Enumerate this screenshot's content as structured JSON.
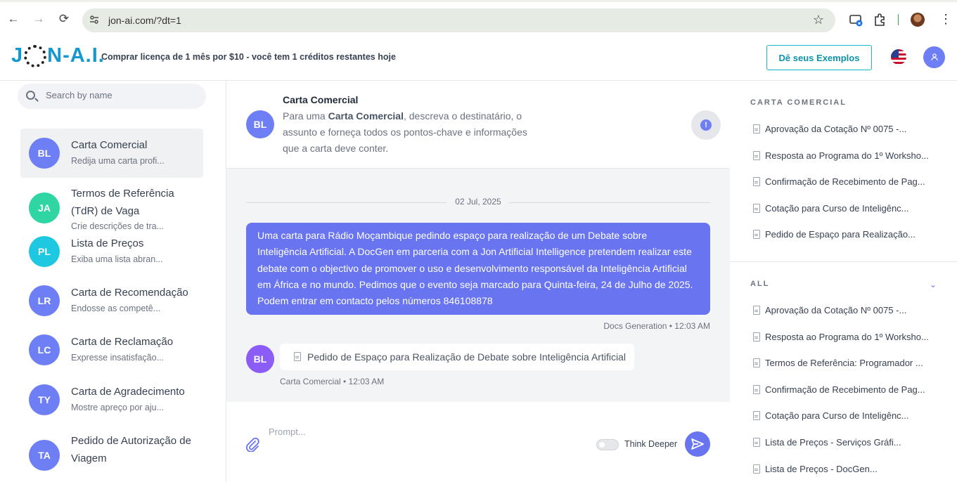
{
  "browser": {
    "url": "jon-ai.com/?dt=1"
  },
  "header": {
    "logo_part1": "J",
    "logo_part2": "N-A.I.",
    "promo": "Comprar licença de 1 mês por $10 - você tem 1 créditos restantes hoje",
    "examples_button": "Dê seus Exemplos",
    "user_initial_icon": "user-icon"
  },
  "sidebar": {
    "search_placeholder": "Search by name",
    "items": [
      {
        "initials": "BL",
        "name": "Carta Comercial",
        "desc": "Redija uma carta profi...",
        "color": "#6e7ef4",
        "active": true
      },
      {
        "initials": "JA",
        "name": "Termos de Referência (TdR) de Vaga",
        "desc": "Crie descrições de tra...",
        "color": "#2fd6a3"
      },
      {
        "initials": "PL",
        "name": "Lista de Preços",
        "desc": "Exiba uma lista abran...",
        "color": "#1ec8e0"
      },
      {
        "initials": "LR",
        "name": "Carta de Recomendação",
        "desc": "Endosse as competê...",
        "color": "#6e7ef4"
      },
      {
        "initials": "LC",
        "name": "Carta de Reclamação",
        "desc": "Expresse insatisfação...",
        "color": "#6e7ef4"
      },
      {
        "initials": "TY",
        "name": "Carta de Agradecimento",
        "desc": "Mostre apreço por aju...",
        "color": "#6e7ef4"
      },
      {
        "initials": "TA",
        "name": "Pedido de Autorização de Viagem",
        "desc": "",
        "color": "#6e7ef4"
      }
    ]
  },
  "chat": {
    "head_initials": "BL",
    "head_title": "Carta Comercial",
    "head_desc_pre": "Para uma ",
    "head_desc_bold": "Carta Comercial",
    "head_desc_post": ", descreva o destinatário, o assunto e forneça todos os pontos-chave e informações que a carta deve conter.",
    "info_symbol": "!",
    "date": "02 Jul, 2025",
    "user_message": "Uma carta para Rádio Moçambique pedindo espaço para realização de um Debate sobre Inteligência Artificial. A DocGen em parceria com a Jon Artificial Intelligence pretendem realizar este debate com o objectivo de promover o uso e desenvolvimento responsável da Inteligência Artificial em África e no mundo. Pedimos que o evento seja marcado para Quinta-feira, 24 de Julho de 2025. Podem entrar em contacto pelos números 846108878",
    "user_meta": "Docs Generation • 12:03 AM",
    "bot_initials": "BL",
    "bot_doc_title": "Pedido de Espaço para Realização de Debate sobre Inteligência Artificial",
    "bot_meta": "Carta Comercial • 12:03 AM",
    "prompt_placeholder": "Prompt...",
    "think_deeper": "Think Deeper"
  },
  "right_panel": {
    "section1_title": "CARTA COMERCIAL",
    "section1_items": [
      "Aprovação da Cotação Nº 0075 -...",
      "Resposta ao Programa do 1º Worksho...",
      "Confirmação de Recebimento de Pag...",
      "Cotação para Curso de Inteligênc...",
      "Pedido de Espaço para Realização..."
    ],
    "section2_title": "ALL",
    "section2_items": [
      "Aprovação da Cotação Nº 0075 -...",
      "Resposta ao Programa do 1º Worksho...",
      "Termos de Referência: Programador ...",
      "Confirmação de Recebimento de Pag...",
      "Cotação para Curso de Inteligênc...",
      "Lista de Preços - Serviços Gráfi...",
      "Lista de Preços - DocGen..."
    ]
  },
  "colors": {
    "accent": "#6874f0",
    "teal": "#14b8c8",
    "logo_blue": "#1598cf"
  }
}
